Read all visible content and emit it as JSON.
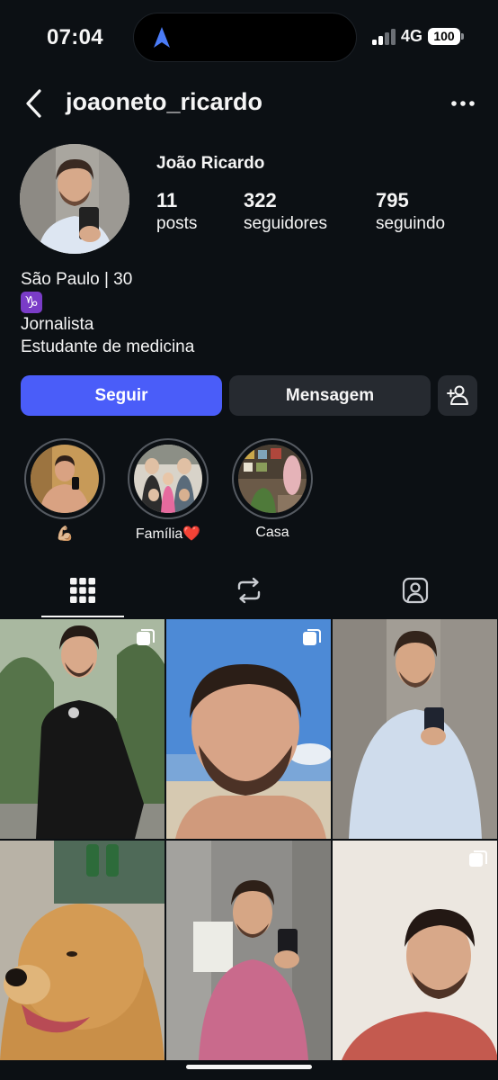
{
  "status_bar": {
    "time": "07:04",
    "network": "4G",
    "battery": "100"
  },
  "header": {
    "username": "joaoneto_ricardo",
    "icons": [
      "back-chevron-icon",
      "more-options-icon"
    ]
  },
  "profile": {
    "full_name": "João Ricardo",
    "stats": [
      {
        "value": "11",
        "label": "posts"
      },
      {
        "value": "322",
        "label": "seguidores"
      },
      {
        "value": "795",
        "label": "seguindo"
      }
    ],
    "bio": {
      "line1": "São Paulo | 30",
      "zodiac": "♑",
      "line3": "Jornalista",
      "line4": "Estudante de medicina"
    }
  },
  "actions": {
    "follow_label": "Seguir",
    "message_label": "Mensagem",
    "add_icon": "add-person-icon"
  },
  "highlights": [
    {
      "label": "💪🏼"
    },
    {
      "label": "Família❤️"
    },
    {
      "label": "Casa"
    }
  ],
  "tabs": [
    {
      "icon": "grid-icon",
      "active": true
    },
    {
      "icon": "reels-repost-icon",
      "active": false
    },
    {
      "icon": "tagged-person-icon",
      "active": false
    }
  ],
  "colors": {
    "background": "#0c1014",
    "accent": "#4a5df9",
    "secondary_button": "#262a30"
  }
}
